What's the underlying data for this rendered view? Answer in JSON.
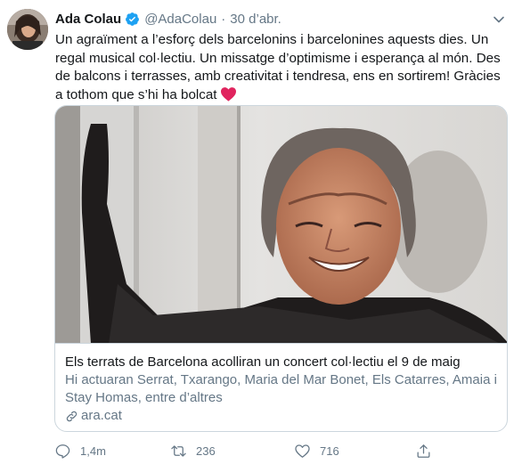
{
  "tweet": {
    "author_name": "Ada Colau",
    "author_handle": "@AdaColau",
    "separator": "·",
    "timestamp": "30 d’abr.",
    "text": "Un agraïment a l’esforç dels barcelonins i barcelonines aquests dies. Un regal musical col·lectiu. Un missatge d’optimisme i esperança al món. Des de balcons i terrasses, amb creativitat i tendresa, ens en sortirem! Gràcies a tothom que s’hi ha bolcat",
    "verified": true
  },
  "card": {
    "title": "Els terrats de Barcelona acolliran un concert col·lectiu el 9 de maig",
    "description": "Hi actuaran Serrat, Txarango, Maria del Mar Bonet, Els Catarres, Amaia i Stay Homas, entre d’altres",
    "domain": "ara.cat"
  },
  "actions": {
    "replies": "1,4m",
    "retweets": "236",
    "likes": "716"
  },
  "icons": {
    "verified": "verified-badge-icon",
    "caret": "chevron-down-icon",
    "heart": "red-heart-emoji",
    "link": "link-icon",
    "reply": "reply-icon",
    "retweet": "retweet-icon",
    "like": "like-heart-icon",
    "share": "share-icon"
  },
  "colors": {
    "text": "#14171a",
    "secondary": "#657786",
    "border": "#ccd6dd",
    "verified": "#1da1f2",
    "heart": "#e0245e"
  }
}
